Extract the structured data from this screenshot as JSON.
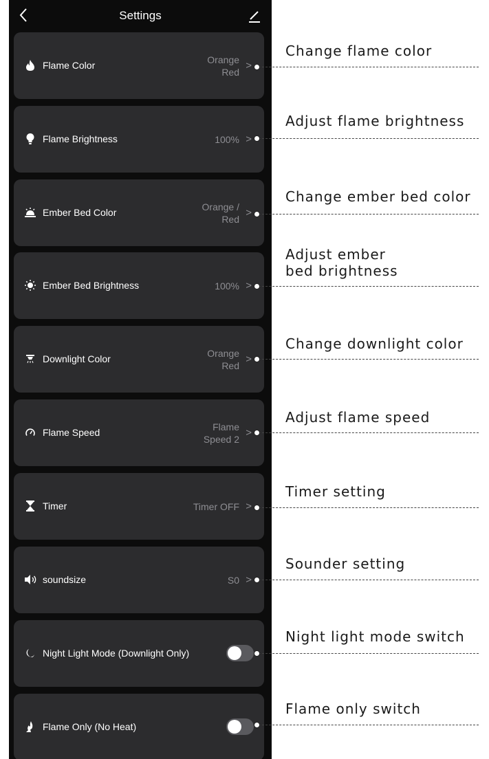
{
  "header": {
    "title": "Settings"
  },
  "rows": [
    {
      "label": "Flame Color",
      "value": "Orange\nRed",
      "icon": "flame-icon"
    },
    {
      "label": "Flame Brightness",
      "value": "100%",
      "icon": "bulb-icon"
    },
    {
      "label": "Ember Bed Color",
      "value": "Orange /\nRed",
      "icon": "ember-bed-icon"
    },
    {
      "label": "Ember Bed Brightness",
      "value": "100%",
      "icon": "sun-icon"
    },
    {
      "label": "Downlight Color",
      "value": "Orange\nRed",
      "icon": "downlight-icon"
    },
    {
      "label": "Flame Speed",
      "value": "Flame\nSpeed 2",
      "icon": "speedometer-icon"
    },
    {
      "label": "Timer",
      "value": "Timer OFF",
      "icon": "hourglass-icon"
    },
    {
      "label": "soundsize",
      "value": "S0",
      "icon": "speaker-icon"
    },
    {
      "label": "Night Light Mode (Downlight Only)",
      "toggle": false,
      "icon": "moon-icon"
    },
    {
      "label": "Flame Only (No Heat)",
      "toggle": false,
      "icon": "flame-only-icon"
    }
  ],
  "callouts": [
    "Change flame color",
    "Adjust flame brightness",
    "Change ember bed color",
    "Adjust ember\nbed brightness",
    "Change downlight color",
    "Adjust flame speed",
    "Timer setting",
    "Sounder setting",
    "Night light mode switch",
    "Flame only switch"
  ],
  "chevron": ">",
  "colors": {
    "background": "#0c0c0c",
    "card": "#2c2c2e",
    "value_text": "#8e8e93",
    "toggle_off": "#5a5a5e"
  }
}
